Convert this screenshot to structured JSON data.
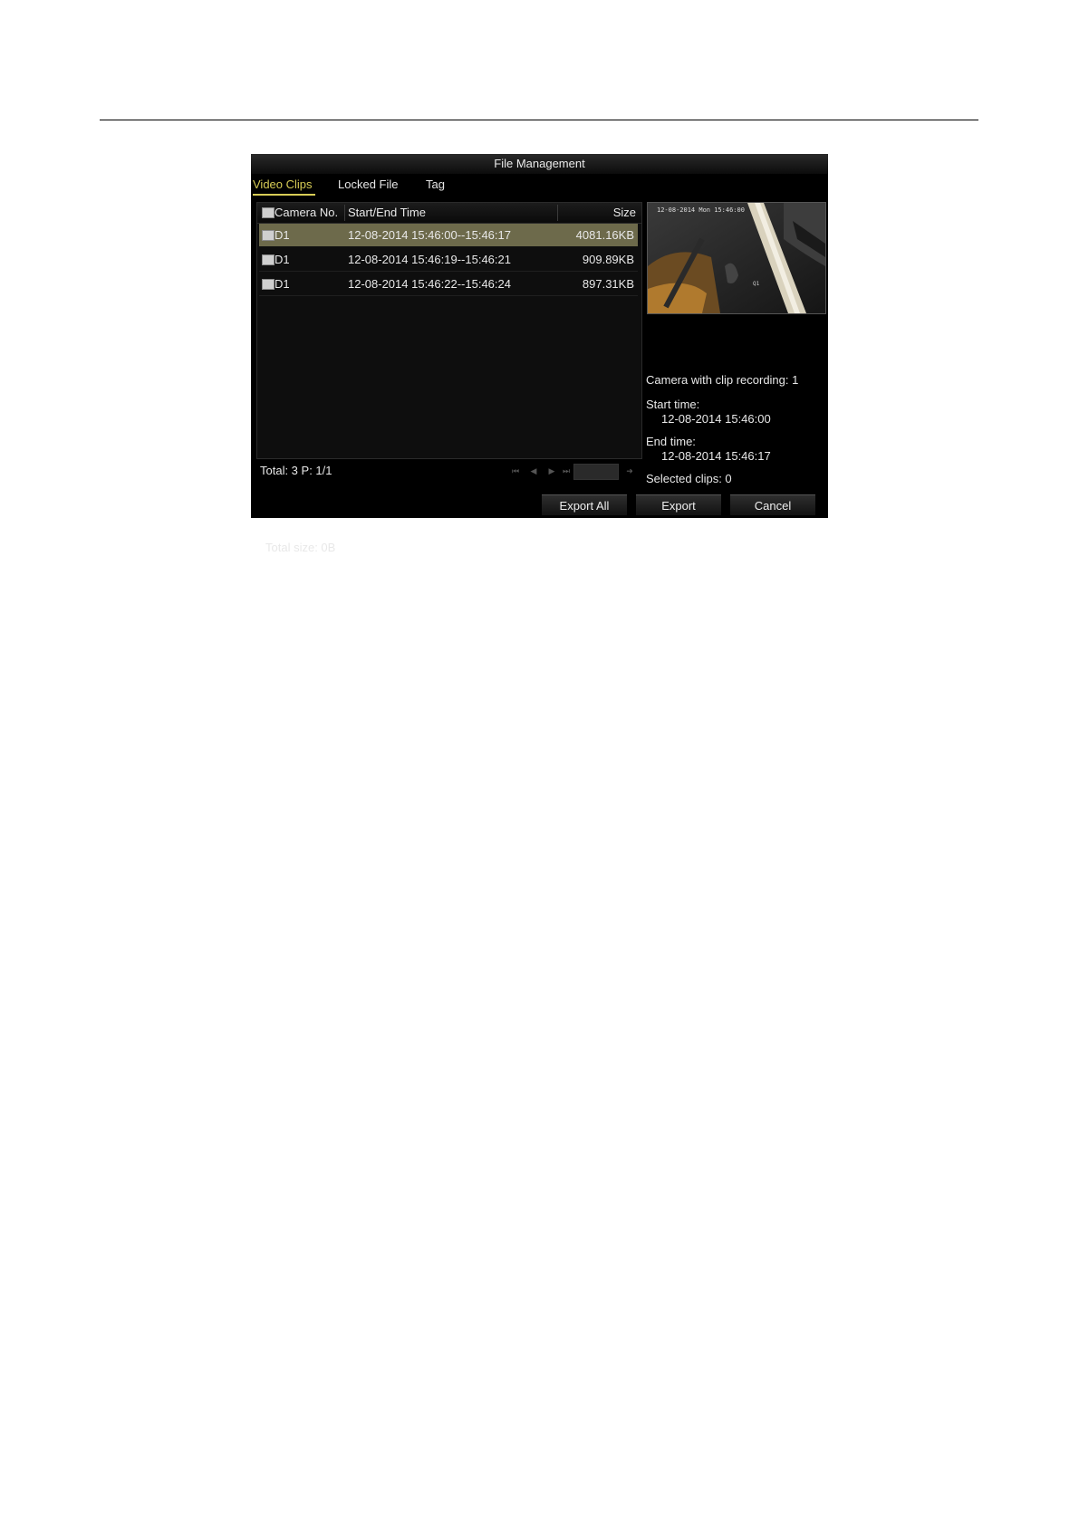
{
  "window": {
    "title": "File Management"
  },
  "tabs": [
    {
      "label": "Video Clips",
      "active": true
    },
    {
      "label": "Locked File",
      "active": false
    },
    {
      "label": "Tag",
      "active": false
    }
  ],
  "table": {
    "headers": {
      "camera": "Camera No.",
      "time": "Start/End Time",
      "size": "Size"
    },
    "rows": [
      {
        "camera": "D1",
        "time": "12-08-2014 15:46:00--15:46:17",
        "size": "4081.16KB",
        "selected": true
      },
      {
        "camera": "D1",
        "time": "12-08-2014 15:46:19--15:46:21",
        "size": "909.89KB",
        "selected": false
      },
      {
        "camera": "D1",
        "time": "12-08-2014 15:46:22--15:46:24",
        "size": "897.31KB",
        "selected": false
      }
    ]
  },
  "pager": {
    "summary": "Total: 3  P: 1/1",
    "first_icon": "first-page-icon",
    "prev_icon": "prev-page-icon",
    "next_icon": "next-page-icon",
    "last_icon": "last-page-icon",
    "go_icon": "go-page-icon"
  },
  "total_size": "Total size: 0B",
  "preview": {
    "timestamp": "12-08-2014 Mon 15:46:00",
    "overlay_text": "Q1"
  },
  "info": {
    "camera_line": "Camera with clip recording: 1",
    "start_label": "Start time:",
    "start_value": "12-08-2014 15:46:00",
    "end_label": "End time:",
    "end_value": "12-08-2014 15:46:17",
    "selected_line": "Selected clips: 0"
  },
  "buttons": {
    "export_all": "Export All",
    "export": "Export",
    "cancel": "Cancel"
  },
  "colors": {
    "accent": "#d7cc55",
    "selected_row": "#6d6a4b"
  }
}
